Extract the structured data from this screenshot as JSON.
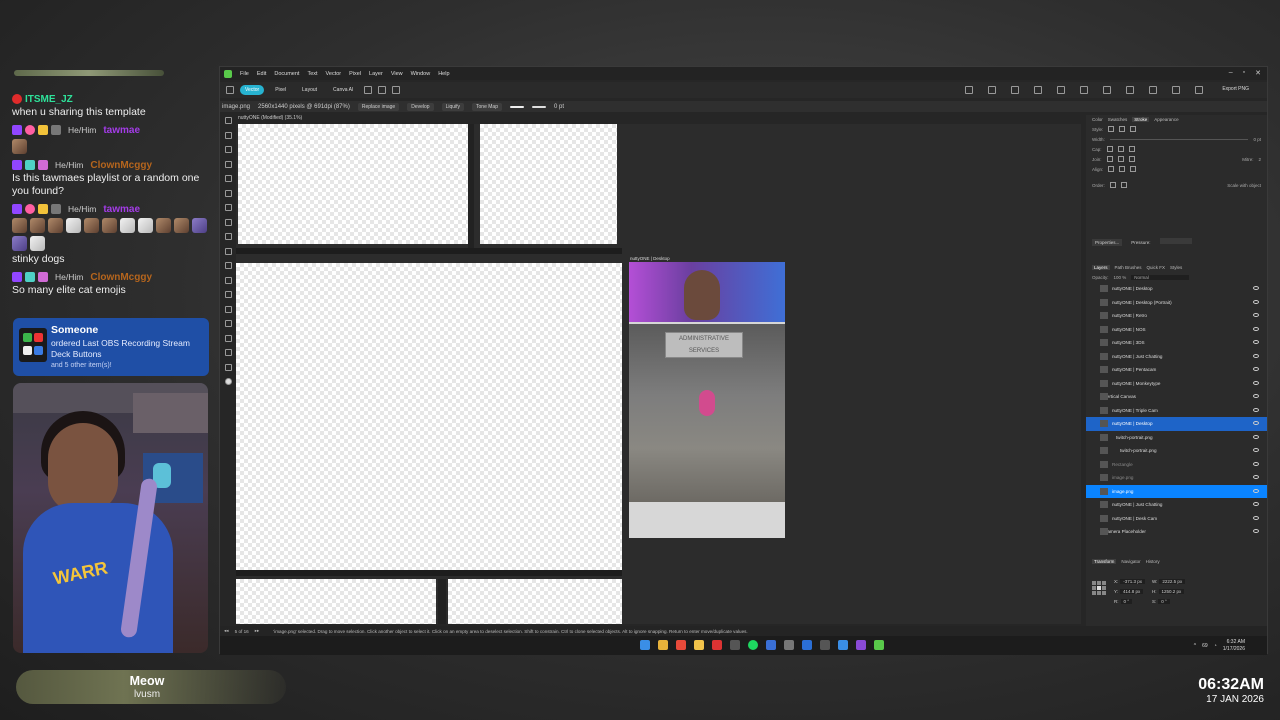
{
  "chat": {
    "messages": [
      {
        "user": "ITSME_JZ",
        "user_color": "#2ee29a",
        "pronouns": "",
        "text": "when u sharing this template"
      },
      {
        "user": "tawmae",
        "user_color": "#a43ce8",
        "pronouns": "He/Him",
        "text": ""
      },
      {
        "user": "ClownMcggy",
        "user_color": "#b5651d",
        "pronouns": "He/Him",
        "text": "Is this tawmaes playlist or a random one you found?"
      },
      {
        "user": "tawmae",
        "user_color": "#a43ce8",
        "pronouns": "He/Him",
        "text": "stinky dogs"
      },
      {
        "user": "ClownMcggy",
        "user_color": "#b5651d",
        "pronouns": "He/Him",
        "text": "So many elite cat emojis"
      }
    ]
  },
  "alert": {
    "name": "Someone",
    "message": "ordered Last OBS Recording Stream Deck Buttons",
    "more": "and 5 other item(s)!"
  },
  "now_playing": {
    "title": "Meow",
    "artist": "lvusm"
  },
  "clock": {
    "time": "06:32AM",
    "date": "17 JAN 2026"
  },
  "app": {
    "menu": [
      "File",
      "Edit",
      "Document",
      "Text",
      "Vector",
      "Pixel",
      "Layer",
      "View",
      "Window",
      "Help"
    ],
    "personas": [
      "Vector",
      "Pixel",
      "Layout",
      "Canva AI"
    ],
    "export_label": "Export PNG",
    "context": {
      "file": "image.png",
      "info": "2560x1440 pixels @ 691dpi (87%)",
      "buttons": [
        "Replace image",
        "Develop",
        "Liquify",
        "Tone Map"
      ],
      "stroke": "0 pt"
    },
    "doc_tab": "nuttyONE (Modified) (35.1%)",
    "artboard_title": "nuttyONE | Desktop",
    "sign_text": "ADMINISTRATIVE SERVICES",
    "panel_tabs_top": [
      "Color",
      "Swatches",
      "Stroke",
      "Appearance"
    ],
    "panel_tabs_top_active": "Stroke",
    "stroke_panel": {
      "labels": [
        "Style:",
        "Width:",
        "Cap:",
        "Join:",
        "Align:",
        "Order:"
      ],
      "width_value": "0 pt",
      "mitre_label": "Mitre:",
      "mitre_value": "2",
      "scale_label": "Scale with object",
      "props_btn": "Properties...",
      "pressure_label": "Pressure:"
    },
    "layers_tabs": [
      "Layers",
      "Path Brushes",
      "Quick FX",
      "Styles"
    ],
    "layers_tabs_active": "Layers",
    "opacity_label": "Opacity:",
    "opacity_value": "100 %",
    "blend_mode": "Normal",
    "layers": [
      {
        "name": "nuttyONE | Desktop",
        "style": "normal"
      },
      {
        "name": "nuttyONE | Desktop (Portrait)",
        "style": "normal"
      },
      {
        "name": "nuttyONE | Retro",
        "style": "normal"
      },
      {
        "name": "nuttyONE | NOS",
        "style": "normal"
      },
      {
        "name": "nuttyONE | 3DS",
        "style": "normal"
      },
      {
        "name": "nuttyONE | Just Chatting",
        "style": "normal"
      },
      {
        "name": "nuttyONE | Pentacam",
        "style": "normal"
      },
      {
        "name": "nuttyONE | Monkeytype",
        "style": "normal"
      },
      {
        "name": "Vertical Canvas",
        "style": "group"
      },
      {
        "name": "nuttyONE | Triple Cam",
        "style": "normal"
      },
      {
        "name": "nuttyONE | Desktop",
        "style": "sel"
      },
      {
        "name": "twitch-portrait.png",
        "style": "ind1"
      },
      {
        "name": "twitch-portrait.png",
        "style": "ind2"
      },
      {
        "name": "Rectangle",
        "style": "dim"
      },
      {
        "name": "image.png",
        "style": "dim"
      },
      {
        "name": "image.png",
        "style": "sel2"
      },
      {
        "name": "nuttyONE | Just Chatting",
        "style": "normal"
      },
      {
        "name": "nuttyONE | Desk Cam",
        "style": "normal"
      },
      {
        "name": "Camera Placeholder",
        "style": "group"
      }
    ],
    "transform_tabs": [
      "Transform",
      "Navigator",
      "History"
    ],
    "transform_tabs_active": "Transform",
    "transform": {
      "x": "-371.3 px",
      "y": "414.8 px",
      "w": "2222.5 px",
      "h": "1250.2 px",
      "r": "0 °",
      "s": "0 °"
    },
    "status": {
      "page": "5 of 16",
      "message": "'image.png' selected. Drag to move selection. Click another object to select it. Click on an empty area to deselect selection. Shift to constrain. Ctrl to clone selected objects. Alt to ignore snapping. Return to enter move/duplicate values."
    },
    "tray": {
      "temp": "69",
      "time": "6:32 AM",
      "date": "1/17/2026"
    }
  },
  "colors": {
    "accent": "#27b3d1",
    "selection": "#1e64c8",
    "alert_bg": "#1f4fa6"
  }
}
